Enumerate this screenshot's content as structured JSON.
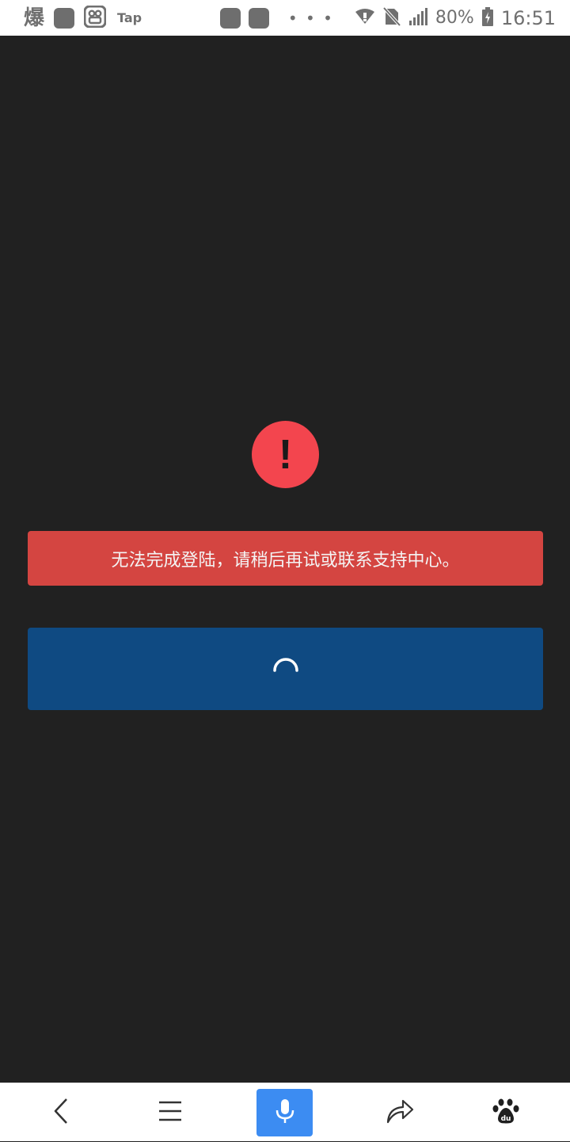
{
  "status_bar": {
    "app_glyph": "爆",
    "tap_label": "Tap",
    "more_dots": "• • •",
    "battery_percent": "80%",
    "time": "16:51"
  },
  "main": {
    "alert_icon": "exclamation-icon",
    "alert_symbol": "!",
    "error_message": "无法完成登陆，请稍后再试或联系支持中心。",
    "primary_button_state": "loading"
  },
  "bottom_nav": {
    "items": [
      "back-icon",
      "menu-icon",
      "microphone-icon",
      "share-icon",
      "baidu-paw-icon"
    ]
  },
  "colors": {
    "background": "#212121",
    "alert_red": "#f3454e",
    "banner_red": "#d44541",
    "button_blue": "#0f4a82",
    "mic_blue": "#3c8cf2"
  }
}
